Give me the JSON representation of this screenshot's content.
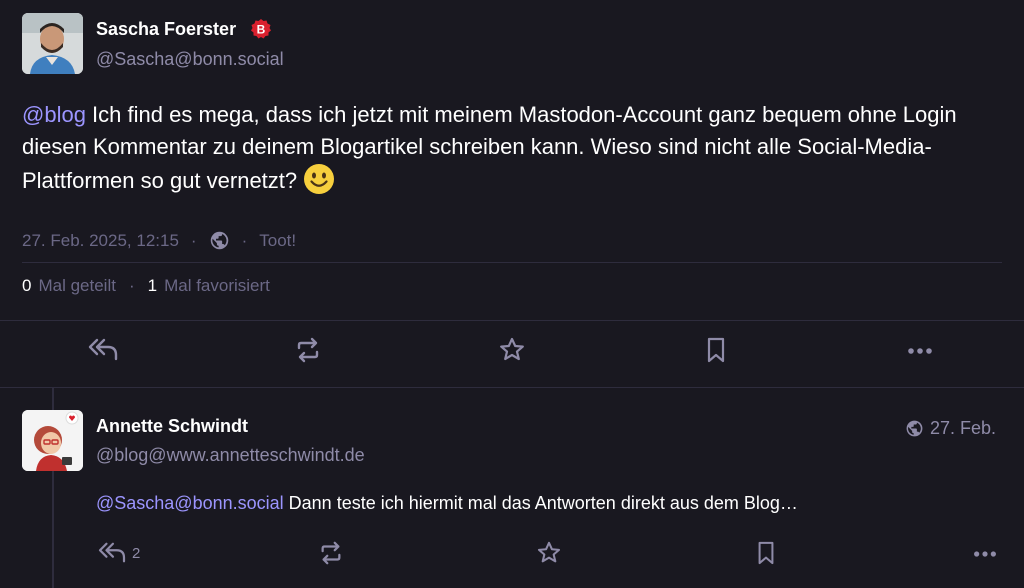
{
  "post": {
    "author_name": "Sascha Foerster",
    "author_handle": "@Sascha@bonn.social",
    "mention": "@blog",
    "text": " Ich find es mega, dass ich jetzt mit meinem Mastodon-Account ganz bequem ohne Login diesen Kommentar zu deinem Blogartikel schreiben kann. Wieso sind nicht alle Social-Media-Plattformen so gut vernetzt?",
    "emoji": "🙂",
    "date": "27. Feb. 2025, 12:15",
    "separator": "·",
    "app": "Toot!",
    "boost_count": "0",
    "boost_label": "Mal geteilt",
    "fav_count": "1",
    "fav_label": "Mal favorisiert",
    "badge_icon": "server-badge-icon"
  },
  "reply": {
    "author_name": "Annette Schwindt",
    "author_handle": "@blog@www.annetteschwindt.de",
    "date": "27. Feb.",
    "mention": "@Sascha@bonn.social",
    "text": " Dann teste ich hiermit mal das Antworten direkt aus dem Blog…",
    "reply_count": "2"
  },
  "colors": {
    "background": "#191820",
    "accent": "#9c95ff",
    "muted": "#6b6886"
  }
}
